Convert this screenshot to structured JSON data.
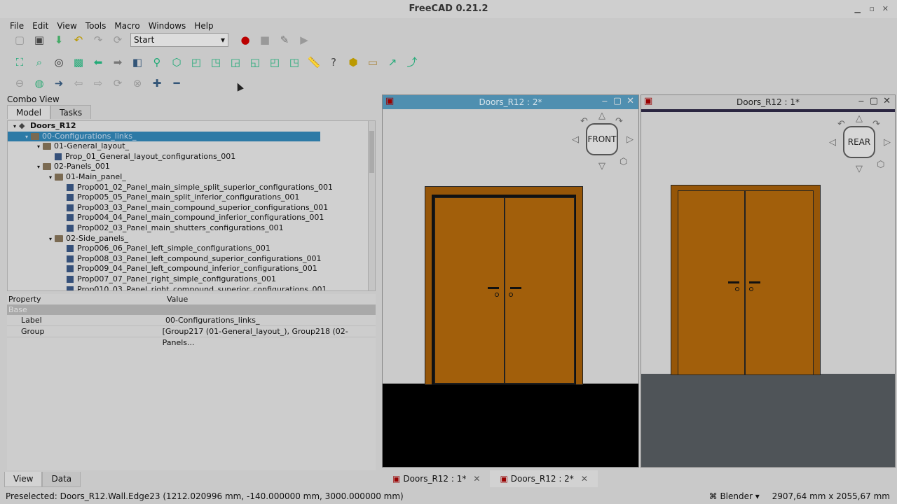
{
  "app": {
    "title": "FreeCAD 0.21.2"
  },
  "menu": [
    "File",
    "Edit",
    "View",
    "Tools",
    "Macro",
    "Windows",
    "Help"
  ],
  "toolbar": {
    "workbench": "Start"
  },
  "combo_view": {
    "title": "Combo View",
    "tabs": [
      "Model",
      "Tasks"
    ],
    "tree": [
      {
        "label": "Doors_R12",
        "indent": 0,
        "kind": "doc",
        "arrow": "▾",
        "bold": true
      },
      {
        "label": "00-Configurations_links_",
        "indent": 1,
        "kind": "folder",
        "arrow": "▾",
        "selected": true
      },
      {
        "label": "01-General_layout_",
        "indent": 2,
        "kind": "folder",
        "arrow": "▾"
      },
      {
        "label": "Prop_01_General_layout_configurations_001",
        "indent": 3,
        "kind": "link",
        "arrow": ""
      },
      {
        "label": "02-Panels_001",
        "indent": 2,
        "kind": "folder",
        "arrow": "▾"
      },
      {
        "label": "01-Main_panel_",
        "indent": 3,
        "kind": "folder",
        "arrow": "▾"
      },
      {
        "label": "Prop001_02_Panel_main_simple_split_superior_configurations_001",
        "indent": 4,
        "kind": "link",
        "arrow": ""
      },
      {
        "label": "Prop005_05_Panel_main_split_inferior_configurations_001",
        "indent": 4,
        "kind": "link",
        "arrow": ""
      },
      {
        "label": "Prop003_03_Panel_main_compound_superior_configurations_001",
        "indent": 4,
        "kind": "link",
        "arrow": ""
      },
      {
        "label": "Prop004_04_Panel_main_compound_inferior_configurations_001",
        "indent": 4,
        "kind": "link",
        "arrow": ""
      },
      {
        "label": "Prop002_03_Panel_main_shutters_configurations_001",
        "indent": 4,
        "kind": "link",
        "arrow": ""
      },
      {
        "label": "02-Side_panels_",
        "indent": 3,
        "kind": "folder",
        "arrow": "▾"
      },
      {
        "label": "Prop006_06_Panel_left_simple_configurations_001",
        "indent": 4,
        "kind": "link",
        "arrow": ""
      },
      {
        "label": "Prop008_03_Panel_left_compound_superior_configurations_001",
        "indent": 4,
        "kind": "link",
        "arrow": ""
      },
      {
        "label": "Prop009_04_Panel_left_compound_inferior_configurations_001",
        "indent": 4,
        "kind": "link",
        "arrow": ""
      },
      {
        "label": "Prop007_07_Panel_right_simple_configurations_001",
        "indent": 4,
        "kind": "link",
        "arrow": ""
      },
      {
        "label": "Prop010_03_Panel_right_compound_superior_configurations_001",
        "indent": 4,
        "kind": "link",
        "arrow": ""
      }
    ],
    "property_header": {
      "property": "Property",
      "value": "Value"
    },
    "property_group": "Base",
    "properties": [
      {
        "name": "Label",
        "value": "00-Configurations_links_"
      },
      {
        "name": "Group",
        "value": "[Group217 (01-General_layout_), Group218 (02-Panels..."
      }
    ],
    "bottom_tabs": [
      "View",
      "Data"
    ]
  },
  "views": [
    {
      "title": "Doors_R12 : 2*",
      "navcube": "FRONT"
    },
    {
      "title": "Doors_R12 : 1*",
      "navcube": "REAR"
    }
  ],
  "doc_tabs": [
    {
      "label": "Doors_R12 : 1*",
      "close": "✕"
    },
    {
      "label": "Doors_R12 : 2*",
      "close": "✕"
    }
  ],
  "status": {
    "message": "Preselected: Doors_R12.Wall.Edge23 (1212.020996 mm, -140.000000 mm, 3000.000000 mm)",
    "navigation": "Blender",
    "dimensions": "2907,64 mm x 2055,67 mm"
  },
  "colors": {
    "accent": "#2d7aa6",
    "door": "#a25f0b",
    "frame": "#965608"
  }
}
